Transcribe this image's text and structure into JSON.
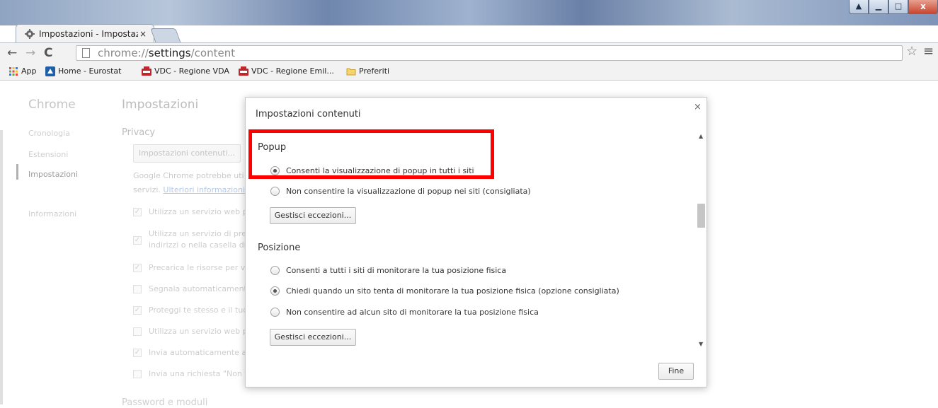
{
  "window": {
    "tab_title": "Impostazioni - Impostazio",
    "tab_close": "×",
    "controls": {
      "min": "▁",
      "max": "□",
      "close": "x",
      "user": "▲"
    }
  },
  "toolbar": {
    "back": "←",
    "forward": "→",
    "reload": "C",
    "url_scheme": "chrome://",
    "url_host": "settings",
    "url_path": "/content",
    "star": "☆",
    "menu": "≡"
  },
  "bookmarks": [
    {
      "label": "App",
      "icon": "apps-grid-icon",
      "color": "#e8453c"
    },
    {
      "label": "Home - Eurostat",
      "icon": "eurostat-icon",
      "color": "#1f5fa8"
    },
    {
      "label": "VDC - Regione VDA",
      "icon": "vdc-icon",
      "color": "#c0262c"
    },
    {
      "label": "VDC - Regione Emil...",
      "icon": "vdc-icon",
      "color": "#c0262c"
    },
    {
      "label": "Preferiti",
      "icon": "folder-icon",
      "color": "#f1c232"
    }
  ],
  "settings_page": {
    "sidebar_title": "Chrome",
    "sidebar_items": [
      "Cronologia",
      "Estensioni",
      "Impostazioni",
      "Informazioni"
    ],
    "active_item": "Impostazioni",
    "page_title": "Impostazioni",
    "section_title": "Privacy",
    "content_settings_button": "Impostazioni contenuti...",
    "desc_line1": "Google Chrome potrebbe uti",
    "desc_line2_prefix": "servizi. ",
    "desc_link": "Ulteriori informazioni",
    "options": [
      {
        "text": "Utilizza un servizio web p",
        "checked": true
      },
      {
        "text": "Utilizza un servizio di prev",
        "text2": "indirizzi o nella casella di",
        "checked": true
      },
      {
        "text": "Precarica le risorse per ve",
        "checked": true
      },
      {
        "text": "Segnala automaticamente",
        "checked": false
      },
      {
        "text": "Proteggi te stesso e il tuo",
        "checked": true
      },
      {
        "text": "Utilizza un servizio web p",
        "checked": false
      },
      {
        "text": "Invia automaticamente a",
        "checked": true
      },
      {
        "text": "Invia una richiesta \"Non t",
        "checked": false
      }
    ],
    "bottom_section": "Password e moduli"
  },
  "dialog": {
    "title": "Impostazioni contenuti",
    "close": "×",
    "sections": [
      {
        "title": "Popup",
        "options": [
          {
            "label": "Consenti la visualizzazione di popup in tutti i siti",
            "checked": true
          },
          {
            "label": "Non consentire la visualizzazione di popup nei siti (consigliata)",
            "checked": false
          }
        ],
        "button": "Gestisci eccezioni..."
      },
      {
        "title": "Posizione",
        "options": [
          {
            "label": "Consenti a tutti i siti di monitorare la tua posizione fisica",
            "checked": false
          },
          {
            "label": "Chiedi quando un sito tenta di monitorare la tua posizione fisica (opzione consigliata)",
            "checked": true
          },
          {
            "label": "Non consentire ad alcun sito di monitorare la tua posizione fisica",
            "checked": false
          }
        ],
        "button": "Gestisci eccezioni..."
      }
    ],
    "scroll_up": "▲",
    "scroll_down": "▼",
    "done_button": "Fine"
  },
  "annotation_color": "#ff0000"
}
